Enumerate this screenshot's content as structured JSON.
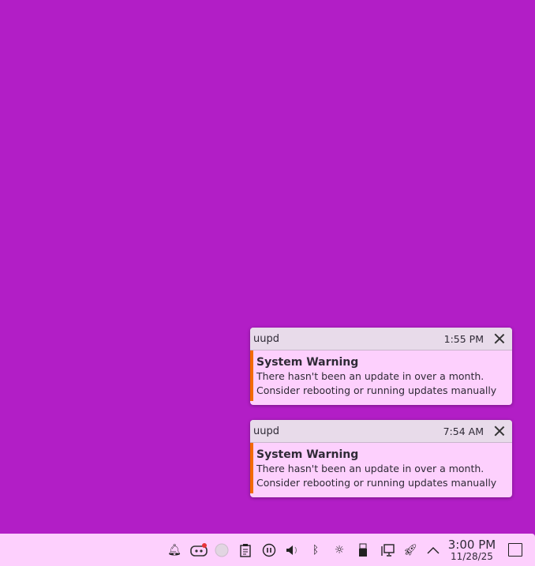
{
  "notifications": [
    {
      "app": "uupd",
      "time": "1:55 PM",
      "title": "System Warning",
      "line1": "There hasn't been an update in over a month.",
      "line2": "Consider rebooting or running updates manually"
    },
    {
      "app": "uupd",
      "time": "7:54 AM",
      "title": "System Warning",
      "line1": "There hasn't been an update in over a month.",
      "line2": "Consider rebooting or running updates manually"
    }
  ],
  "tray": {
    "icons": [
      "notifications-icon",
      "discord-icon",
      "steam-icon",
      "clipboard-icon",
      "media-pause-icon",
      "volume-icon",
      "bluetooth-icon",
      "brightness-icon",
      "usb-drive-icon",
      "network-wired-icon",
      "rocket-icon",
      "expand-tray-icon"
    ]
  },
  "clock": {
    "time": "3:00 PM",
    "date": "11/28/25"
  },
  "colors": {
    "desktop": "#b21ec6",
    "panel": "#fdd0fd",
    "accent": "#f26b00"
  }
}
